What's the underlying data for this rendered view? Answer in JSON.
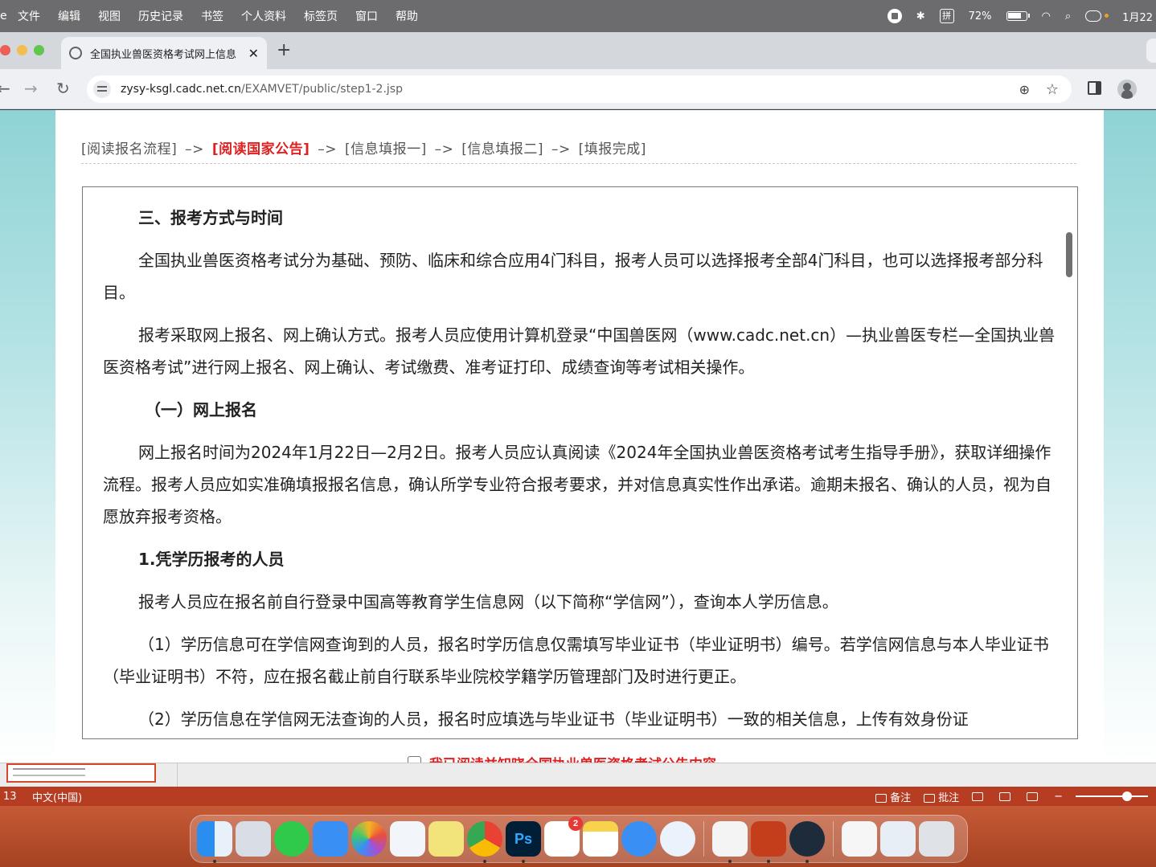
{
  "menubar": {
    "items": [
      "文件",
      "编辑",
      "视图",
      "历史记录",
      "书签",
      "个人资料",
      "标签页",
      "窗口",
      "帮助"
    ],
    "battery": "72%",
    "ime": "拼",
    "clock": "1月22"
  },
  "browser": {
    "tab_title": "全国执业兽医资格考试网上信息",
    "url_domain": "zysy-ksgl.cadc.net.cn",
    "url_path": "/EXAMVET/public/step1-2.jsp"
  },
  "page": {
    "steps": [
      {
        "label": "[阅读报名流程]",
        "active": false
      },
      {
        "label": "[阅读国家公告]",
        "active": true
      },
      {
        "label": "[信息填报一]",
        "active": false
      },
      {
        "label": "[信息填报二]",
        "active": false
      },
      {
        "label": "[填报完成]",
        "active": false
      }
    ],
    "step_arrow": "–>",
    "notice": {
      "heading": "三、报考方式与时间",
      "p1": "全国执业兽医资格考试分为基础、预防、临床和综合应用4门科目，报考人员可以选择报考全部4门科目，也可以选择报考部分科目。",
      "p2": "报考采取网上报名、网上确认方式。报考人员应使用计算机登录“中国兽医网（www.cadc.net.cn）—执业兽医专栏—全国执业兽医资格考试”进行网上报名、网上确认、考试缴费、准考证打印、成绩查询等考试相关操作。",
      "sub_heading": "（一）网上报名",
      "p3": "网上报名时间为2024年1月22日—2月2日。报考人员应认真阅读《2024年全国执业兽医资格考试考生指导手册》，获取详细操作流程。报考人员应如实准确填报报名信息，确认所学专业符合报考要求，并对信息真实性作出承诺。逾期未报名、确认的人员，视为自愿放弃报考资格。",
      "section_1": "1.凭学历报考的人员",
      "p4": "报考人员应在报名前自行登录中国高等教育学生信息网（以下简称“学信网”），查询本人学历信息。",
      "p5": "（1）学历信息可在学信网查询到的人员，报名时学历信息仅需填写毕业证书（毕业证明书）编号。若学信网信息与本人毕业证书（毕业证明书）不符，应在报名截止前自行联系毕业院校学籍学历管理部门及时进行更正。",
      "p6": "（2）学历信息在学信网无法查询的人员，报名时应填选与毕业证书（毕业证明书）一致的相关信息，上传有效身份证"
    },
    "agree_label": "我已阅读并知晓全国执业兽医资格考试公告内容"
  },
  "ppt_status": {
    "slide_no": "13",
    "language": "中文(中国)",
    "notes_label": "备注",
    "comments_label": "批注"
  },
  "dock": {
    "apps": [
      "finder-icon",
      "launchpad-icon",
      "messages-icon",
      "mail-icon",
      "photos-icon",
      "baidu-netdisk-icon",
      "stickies-icon",
      "chrome-icon",
      "photoshop-icon",
      "reminders-icon",
      "notes-icon",
      "safari-icon",
      "quicktime-icon",
      "textedit-icon",
      "powerpoint-icon",
      "screen-recorder-icon",
      "pdf-document-icon",
      "keyboard-viewer-icon",
      "trash-icon"
    ],
    "ps_label": "Ps",
    "reminders_badge": "2"
  },
  "colors": {
    "active_step": "#e02020",
    "agree_text": "#e02020",
    "ppt_accent": "#b63c22"
  }
}
